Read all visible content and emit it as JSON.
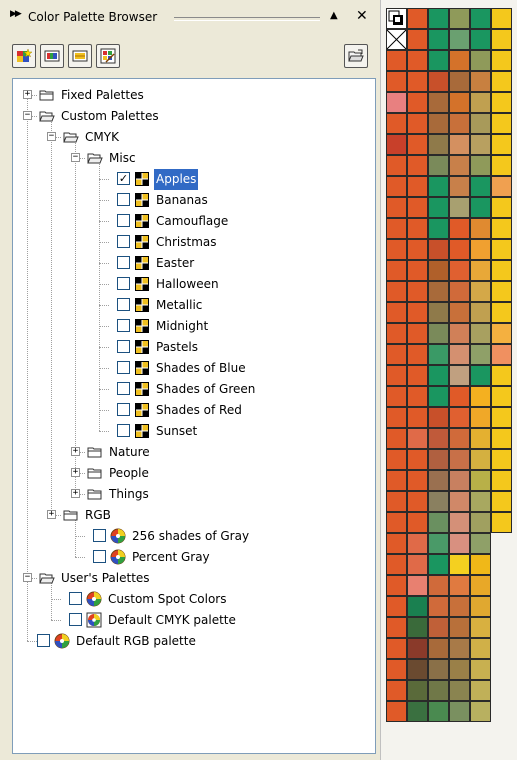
{
  "title": "Color Palette Browser",
  "tree": {
    "rows": [
      {
        "id": "fixed",
        "label": "Fixed Palettes",
        "level": 0,
        "exp": "plus",
        "icon": "folder-closed-icon"
      },
      {
        "id": "custom",
        "label": "Custom Palettes",
        "level": 0,
        "exp": "minus",
        "icon": "folder-open-icon"
      },
      {
        "id": "cmyk",
        "label": "CMYK",
        "level": 1,
        "exp": "minus",
        "icon": "folder-open-icon"
      },
      {
        "id": "misc",
        "label": "Misc",
        "level": 2,
        "exp": "minus",
        "icon": "folder-open-icon"
      },
      {
        "id": "apples",
        "label": "Apples",
        "level": 3,
        "checked": true,
        "selected": true,
        "icon": "palette-grid-icon"
      },
      {
        "id": "bananas",
        "label": "Bananas",
        "level": 3,
        "checked": false,
        "icon": "palette-grid-icon"
      },
      {
        "id": "camouflage",
        "label": "Camouflage",
        "level": 3,
        "checked": false,
        "icon": "palette-grid-icon"
      },
      {
        "id": "christmas",
        "label": "Christmas",
        "level": 3,
        "checked": false,
        "icon": "palette-grid-icon"
      },
      {
        "id": "easter",
        "label": "Easter",
        "level": 3,
        "checked": false,
        "icon": "palette-grid-icon"
      },
      {
        "id": "halloween",
        "label": "Halloween",
        "level": 3,
        "checked": false,
        "icon": "palette-grid-icon"
      },
      {
        "id": "metallic",
        "label": "Metallic",
        "level": 3,
        "checked": false,
        "icon": "palette-grid-icon"
      },
      {
        "id": "midnight",
        "label": "Midnight",
        "level": 3,
        "checked": false,
        "icon": "palette-grid-icon"
      },
      {
        "id": "pastels",
        "label": "Pastels",
        "level": 3,
        "checked": false,
        "icon": "palette-grid-icon"
      },
      {
        "id": "shades-blue",
        "label": "Shades of Blue",
        "level": 3,
        "checked": false,
        "icon": "palette-grid-icon"
      },
      {
        "id": "shades-green",
        "label": "Shades of Green",
        "level": 3,
        "checked": false,
        "icon": "palette-grid-icon"
      },
      {
        "id": "shades-red",
        "label": "Shades of Red",
        "level": 3,
        "checked": false,
        "icon": "palette-grid-icon"
      },
      {
        "id": "sunset",
        "label": "Sunset",
        "level": 3,
        "checked": false,
        "icon": "palette-grid-icon"
      },
      {
        "id": "nature",
        "label": "Nature",
        "level": 2,
        "exp": "plus",
        "icon": "folder-closed-icon"
      },
      {
        "id": "people",
        "label": "People",
        "level": 2,
        "exp": "plus",
        "icon": "folder-closed-icon"
      },
      {
        "id": "things",
        "label": "Things",
        "level": 2,
        "exp": "plus",
        "icon": "folder-closed-icon"
      },
      {
        "id": "rgb",
        "label": "RGB",
        "level": 1,
        "exp": "plus",
        "icon": "folder-closed-icon"
      },
      {
        "id": "gray256",
        "label": "256 shades of Gray",
        "level": 2,
        "checked": false,
        "icon": "color-wheel-icon"
      },
      {
        "id": "percentgray",
        "label": "Percent Gray",
        "level": 2,
        "checked": false,
        "icon": "color-wheel-icon"
      },
      {
        "id": "users",
        "label": "User's Palettes",
        "level": 0,
        "exp": "minus",
        "icon": "folder-open-icon"
      },
      {
        "id": "customspot",
        "label": "Custom Spot Colors",
        "level": 1,
        "checked": false,
        "icon": "color-wheel-icon"
      },
      {
        "id": "defcmyk",
        "label": "Default CMYK palette",
        "level": 1,
        "checked": false,
        "icon": "color-wheel-doc-icon"
      },
      {
        "id": "defrgb",
        "label": "Default RGB palette",
        "level": -1,
        "checked": false,
        "icon": "color-wheel-icon"
      }
    ]
  },
  "palette": {
    "rows": [
      [
        "special",
        "#e05a28",
        "#1a9660",
        "#8f9a5a",
        "#1a9660",
        "#f4c81c"
      ],
      [
        "none",
        "#e05a28",
        "#1a9660",
        "#6aa070",
        "#1a9660",
        "#f4c81c"
      ],
      [
        "#e05a28",
        "#e05a28",
        "#1a9660",
        "#d4722a",
        "#8f9a5a",
        "#f4c81c"
      ],
      [
        "#e05a28",
        "#e05a28",
        "#c8502a",
        "#a86a3a",
        "#c88040",
        "#f4c81c"
      ],
      [
        "#e88080",
        "#e05a28",
        "#a86a3a",
        "#d4722a",
        "#c0a050",
        "#f4c81c"
      ],
      [
        "#e05a28",
        "#e05a28",
        "#a86a3a",
        "#c8703a",
        "#a89a5a",
        "#f4c81c"
      ],
      [
        "#c8402a",
        "#e05a28",
        "#8f7a4a",
        "#d49060",
        "#b8a060",
        "#f4c81c"
      ],
      [
        "#e05a28",
        "#e05a28",
        "#7a8a5a",
        "#c8804a",
        "#8f9a5a",
        "#f4c81c"
      ],
      [
        "#e05a28",
        "#e05a28",
        "#1a9660",
        "#c8804a",
        "#1a9660",
        "#f0a050"
      ],
      [
        "#e05a28",
        "#e05a28",
        "#1a9660",
        "#a8a070",
        "#1a9660",
        "#f4c81c"
      ],
      [
        "#e05a28",
        "#e05a28",
        "#1a9660",
        "#e05a28",
        "#e08a30",
        "#f4c81c"
      ],
      [
        "#e05a28",
        "#e05a28",
        "#c8502a",
        "#e05a28",
        "#f0a030",
        "#f4c81c"
      ],
      [
        "#e05a28",
        "#e05a28",
        "#b0602a",
        "#e06030",
        "#e8a838",
        "#f4c81c"
      ],
      [
        "#e05a28",
        "#e05a28",
        "#a86a3a",
        "#d06a3a",
        "#d4a848",
        "#f4c81c"
      ],
      [
        "#e05a28",
        "#e05a28",
        "#8f7a4a",
        "#c8703a",
        "#c0a050",
        "#f4c81c"
      ],
      [
        "#e05a28",
        "#e05a28",
        "#7a8a5a",
        "#d08058",
        "#a8a060",
        "#f4b040"
      ],
      [
        "#e05a28",
        "#e05a28",
        "#3a9a66",
        "#d49070",
        "#8fa068",
        "#f09060"
      ],
      [
        "#e05a28",
        "#e05a28",
        "#1a9660",
        "#c0a080",
        "#1a9660",
        "#f4c81c"
      ],
      [
        "#e05a28",
        "#e05a28",
        "#1a9660",
        "#e05a28",
        "#f4b020",
        "#f4c81c"
      ],
      [
        "#e05a28",
        "#e05a28",
        "#c8502a",
        "#e06030",
        "#f0a828",
        "#f4c81c"
      ],
      [
        "#e05a28",
        "#e06a48",
        "#c05a3a",
        "#d06a3a",
        "#e4b030",
        "#f4c81c"
      ],
      [
        "#e05a28",
        "#e05a28",
        "#b06040",
        "#c87048",
        "#d4b040",
        "#f4c81c"
      ],
      [
        "#e05a28",
        "#e05a28",
        "#9a7050",
        "#c88060",
        "#b8b048",
        "#f4c81c"
      ],
      [
        "#e05a28",
        "#e05a28",
        "#8a8060",
        "#d08868",
        "#a8a860",
        "#f4c81c"
      ],
      [
        "#e05a28",
        "#e05a28",
        "#6a9060",
        "#d49078",
        "#a0a060",
        "#f4c81c"
      ],
      [
        "#e05a28",
        "#e06a48",
        "#4a9a68",
        "#d89080",
        "#8fa068",
        ""
      ],
      [
        "#e05a28",
        "#e06a48",
        "#1a9660",
        "#f4d020",
        "#f0b818",
        ""
      ],
      [
        "#e05a28",
        "#e88070",
        "#d06a3a",
        "#e07a40",
        "#e8a828",
        ""
      ],
      [
        "#e05a28",
        "#1a8050",
        "#d06a3a",
        "#c8703a",
        "#e0a830",
        ""
      ],
      [
        "#e05a28",
        "#3a6a3a",
        "#c06038",
        "#b8703a",
        "#d8b040",
        ""
      ],
      [
        "#e05a28",
        "#8a3a2a",
        "#a86a3a",
        "#a87a48",
        "#d0b048",
        ""
      ],
      [
        "#e05a28",
        "#6a4a30",
        "#8a7048",
        "#9a8048",
        "#c8b050",
        ""
      ],
      [
        "#e05a28",
        "#5a6a3a",
        "#707848",
        "#8a8450",
        "#c0b058",
        ""
      ],
      [
        "#e05a28",
        "#3a7040",
        "#4a8a50",
        "#7a9060",
        "#b8b060",
        ""
      ]
    ]
  }
}
